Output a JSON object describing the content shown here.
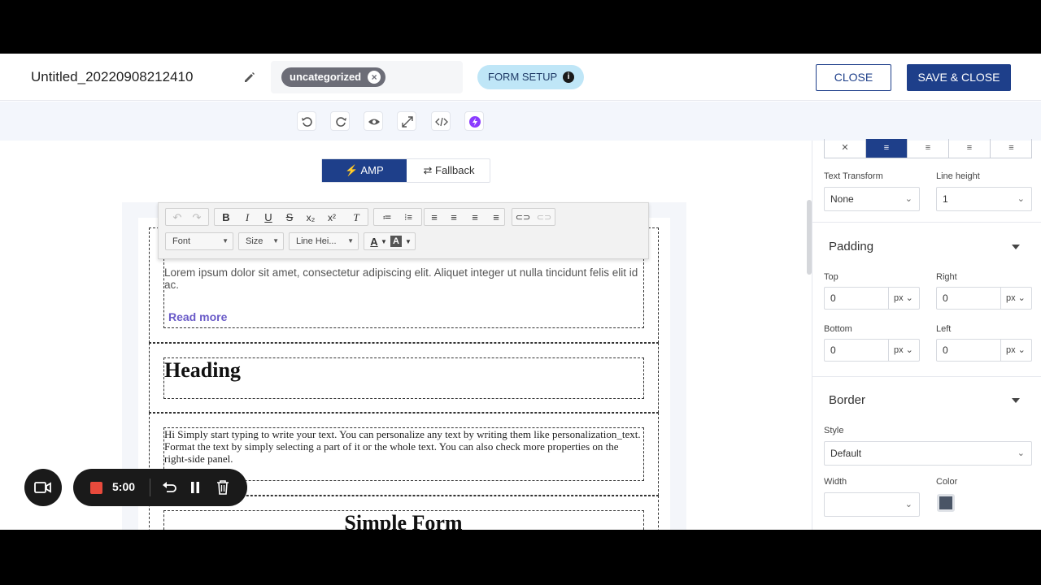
{
  "header": {
    "title": "Untitled_20220908212410",
    "tag": "uncategorized",
    "form_setup": "FORM SETUP",
    "close": "CLOSE",
    "save_close": "SAVE & CLOSE"
  },
  "mode": {
    "amp": "AMP",
    "fallback": "Fallback",
    "amp_icon": "bolt-icon",
    "fallback_icon": "swap-icon"
  },
  "rte": {
    "font": "Font",
    "size": "Size",
    "line_height": "Line Hei..."
  },
  "content": {
    "lorem": "Lorem ipsum dolor sit amet, consectetur adipiscing elit. Aliquet integer ut nulla tincidunt felis elit id ac.",
    "read_more": "Read more",
    "heading": "Heading",
    "paragraph": "Hi Simply start typing to write your text. You can personalize any text by writing them like personalization_text. Format the text by simply selecting a part of it or the whole text. You can also check more properties on the right-side panel.",
    "simple_form": "Simple Form"
  },
  "recorder": {
    "time": "5:00",
    "record_color": "#e84a3c"
  },
  "panel": {
    "text_transform_label": "Text Transform",
    "text_transform_value": "None",
    "line_height_label": "Line height",
    "line_height_value": "1",
    "padding_title": "Padding",
    "top_label": "Top",
    "top_value": "0",
    "right_label": "Right",
    "right_value": "0",
    "bottom_label": "Bottom",
    "bottom_value": "0",
    "left_label": "Left",
    "left_value": "0",
    "unit": "px",
    "border_title": "Border",
    "style_label": "Style",
    "style_value": "Default",
    "width_label": "Width",
    "color_label": "Color",
    "border_color": "#4a5566"
  },
  "colors": {
    "primary": "#1e3f8a",
    "accent_purple": "#8b3dff"
  }
}
